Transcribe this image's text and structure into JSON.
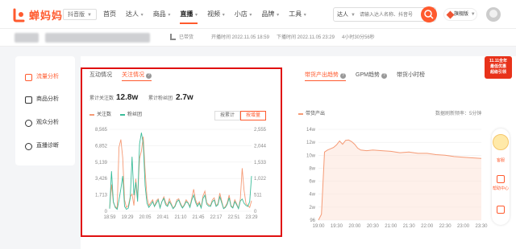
{
  "brand": {
    "name": "蝉妈妈",
    "accent": "#ff5a2e"
  },
  "platform": "抖音版",
  "nav": [
    {
      "label": "首页",
      "dropdown": false
    },
    {
      "label": "达人",
      "dropdown": true
    },
    {
      "label": "商品",
      "dropdown": true
    },
    {
      "label": "直播",
      "dropdown": true,
      "active": true
    },
    {
      "label": "视频",
      "dropdown": true
    },
    {
      "label": "小店",
      "dropdown": true
    },
    {
      "label": "品牌",
      "dropdown": true
    },
    {
      "label": "工具",
      "dropdown": true
    }
  ],
  "search": {
    "type": "达人",
    "placeholder": "请输入达人名称、抖音号"
  },
  "vip_label": "旗舰版",
  "live_info": {
    "status": "已带货",
    "start": "开播时间  2022.11.05 18:59",
    "end": "下播时间  2022.11.05 23:29",
    "duration": "4小时30分56秒"
  },
  "sidebar": [
    {
      "label": "流量分析",
      "icon": "flow-icon",
      "active": true
    },
    {
      "label": "商品分析",
      "icon": "goods-icon",
      "active": false
    },
    {
      "label": "观众分析",
      "icon": "audience-icon",
      "active": false
    },
    {
      "label": "直播诊断",
      "icon": "diagnosis-icon",
      "active": false
    }
  ],
  "left_panel": {
    "tabs": [
      {
        "label": "互动情况",
        "active": false
      },
      {
        "label": "关注情况",
        "active": true
      }
    ],
    "stats": [
      {
        "label": "累计关注数",
        "value": "12.8w"
      },
      {
        "label": "累计粉丝团",
        "value": "2.7w"
      }
    ],
    "toggles": [
      {
        "label": "按累计",
        "active": false
      },
      {
        "label": "按增量",
        "active": true
      }
    ]
  },
  "right_panel": {
    "tabs": [
      {
        "label": "带货产出趋势",
        "active": true,
        "help": true
      },
      {
        "label": "GPM趋势",
        "active": false,
        "help": true
      },
      {
        "label": "带货小时榜",
        "active": false,
        "help": false
      }
    ],
    "update_note": "数据刷新频率：5分钟"
  },
  "float": {
    "promo": [
      "11.11全年",
      "最低优惠",
      "超级引领"
    ],
    "items": [
      "客服",
      "帮助中心"
    ]
  },
  "chart_data": [
    {
      "type": "line",
      "x_ticks": [
        "18:59",
        "19:29",
        "20:05",
        "20:41",
        "21:10",
        "21:45",
        "22:17",
        "22:51",
        "23:29"
      ],
      "y_left_ticks": [
        "0",
        "1,713",
        "3,426",
        "5,139",
        "6,852",
        "8,565"
      ],
      "y_right_ticks": [
        "0",
        "511",
        "1,022",
        "1,533",
        "2,044",
        "2,555"
      ],
      "ylim_left": [
        0,
        8565
      ],
      "ylim_right": [
        0,
        2555
      ],
      "legend_position": "top-left",
      "series": [
        {
          "name": "关注数",
          "color": "#f59a75",
          "axis": "left",
          "values": [
            300,
            2800,
            900,
            500,
            300,
            6700,
            7500,
            5600,
            1200,
            400,
            600,
            1500,
            1800,
            600,
            3400,
            1400,
            5500,
            6300,
            7800,
            4200,
            1500,
            600,
            900,
            1200,
            500,
            1100,
            1300,
            400,
            1000,
            1500,
            900,
            600,
            1300,
            800,
            300,
            600,
            1200,
            1300,
            800,
            400,
            700,
            1200,
            900,
            500,
            1400,
            2300,
            1200,
            700,
            1000,
            400,
            1600,
            2100,
            900,
            700,
            600,
            1200,
            1400,
            600,
            800,
            1900,
            1100,
            300,
            500,
            900,
            1700,
            600,
            400,
            1200,
            800,
            300,
            1300,
            4500,
            2200,
            800,
            600,
            400,
            1100
          ]
        },
        {
          "name": "粉丝团",
          "color": "#3bbd9a",
          "axis": "right",
          "values": [
            80,
            1250,
            300,
            120,
            60,
            350,
            700,
            1100,
            150,
            60,
            100,
            400,
            1700,
            500,
            900,
            300,
            2100,
            2450,
            2100,
            800,
            250,
            120,
            200,
            300,
            150,
            250,
            350,
            100,
            300,
            400,
            200,
            150,
            300,
            200,
            80,
            150,
            300,
            350,
            200,
            100,
            180,
            300,
            250,
            120,
            350,
            500,
            280,
            150,
            250,
            100,
            400,
            500,
            220,
            160,
            150,
            300,
            350,
            150,
            200,
            450,
            270,
            80,
            120,
            220,
            420,
            150,
            100,
            300,
            200,
            80,
            320,
            380,
            250,
            180,
            150,
            300,
            1100
          ]
        }
      ]
    },
    {
      "type": "area",
      "x_ticks": [
        "19:00",
        "19:30",
        "20:00",
        "20:30",
        "21:00",
        "21:30",
        "22:00",
        "22:30",
        "23:00",
        "23:30"
      ],
      "y_ticks": [
        "96",
        "2w",
        "4w",
        "6w",
        "8w",
        "10w",
        "12w",
        "14w"
      ],
      "series": [
        {
          "name": "带货产出",
          "color": "#f59a75",
          "x": [
            "19:00",
            "19:05",
            "19:10",
            "19:15",
            "19:20",
            "19:25",
            "19:30",
            "19:35",
            "19:40",
            "19:45",
            "19:50",
            "19:55",
            "20:00",
            "20:05",
            "20:10",
            "20:20",
            "20:30",
            "20:45",
            "21:00",
            "21:15",
            "21:30",
            "21:45",
            "22:00",
            "22:15",
            "22:30",
            "22:45",
            "23:00",
            "23:15",
            "23:30"
          ],
          "values": [
            0,
            9000,
            105000,
            108000,
            110000,
            112000,
            116000,
            122000,
            117000,
            123000,
            123500,
            121000,
            117000,
            111000,
            108000,
            107000,
            108000,
            107000,
            106000,
            104000,
            105000,
            103000,
            103000,
            101000,
            100000,
            98000,
            97000,
            96000,
            95000
          ]
        }
      ]
    }
  ]
}
